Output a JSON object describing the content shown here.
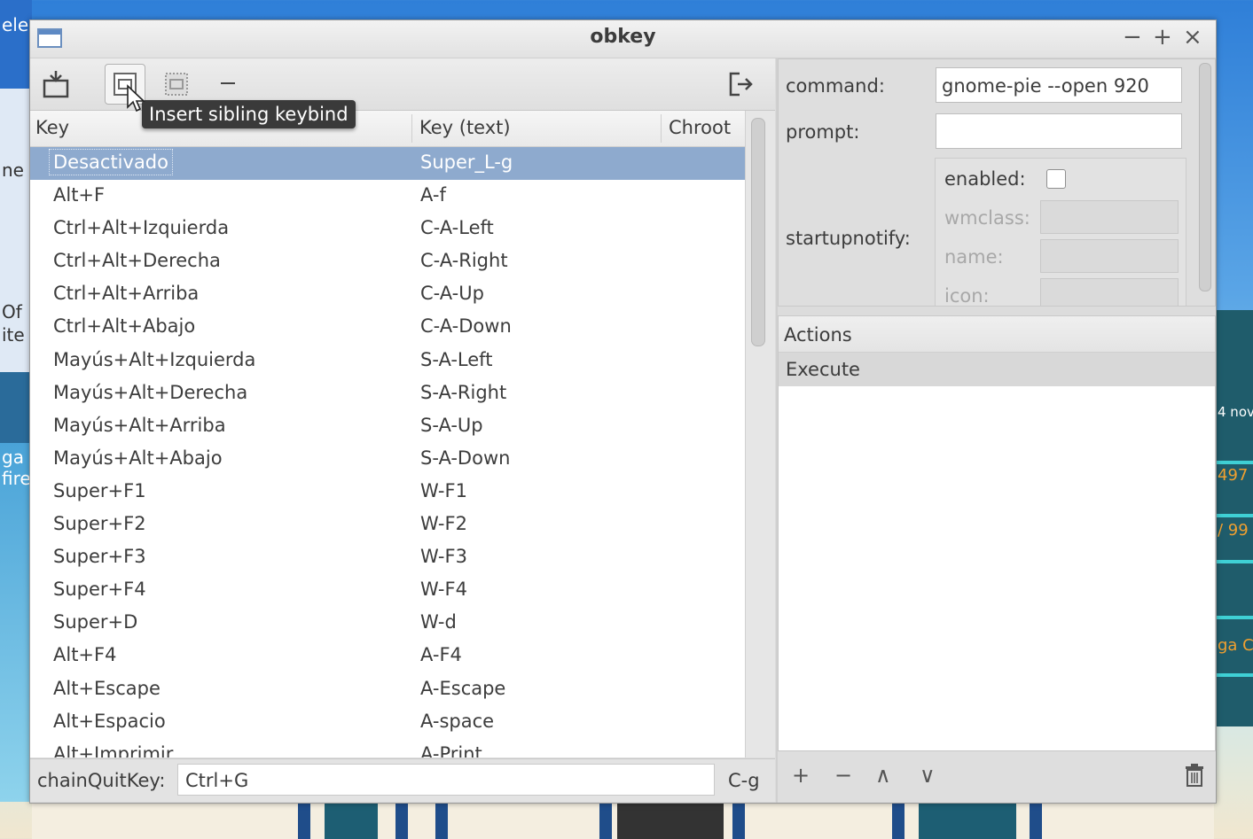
{
  "window": {
    "title": "obkey",
    "controls": {
      "minimize": "−",
      "maximize": "+",
      "close": "×"
    }
  },
  "desktop": {
    "fragments": [
      "ele",
      "ne",
      "Of",
      "ite",
      "ga",
      "fire",
      "4 nov",
      "497",
      "/ 99",
      "ga C"
    ]
  },
  "toolbar": {
    "tooltip": "Insert sibling keybind"
  },
  "table": {
    "headers": {
      "key": "Key",
      "key_text": "Key (text)",
      "chroot": "Chroot"
    },
    "rows": [
      {
        "key": "Desactivado",
        "key_text": "Super_L-g",
        "selected": true
      },
      {
        "key": "Alt+F",
        "key_text": "A-f"
      },
      {
        "key": "Ctrl+Alt+Izquierda",
        "key_text": "C-A-Left"
      },
      {
        "key": "Ctrl+Alt+Derecha",
        "key_text": "C-A-Right"
      },
      {
        "key": "Ctrl+Alt+Arriba",
        "key_text": "C-A-Up"
      },
      {
        "key": "Ctrl+Alt+Abajo",
        "key_text": "C-A-Down"
      },
      {
        "key": "Mayús+Alt+Izquierda",
        "key_text": "S-A-Left"
      },
      {
        "key": "Mayús+Alt+Derecha",
        "key_text": "S-A-Right"
      },
      {
        "key": "Mayús+Alt+Arriba",
        "key_text": "S-A-Up"
      },
      {
        "key": "Mayús+Alt+Abajo",
        "key_text": "S-A-Down"
      },
      {
        "key": "Super+F1",
        "key_text": "W-F1"
      },
      {
        "key": "Super+F2",
        "key_text": "W-F2"
      },
      {
        "key": "Super+F3",
        "key_text": "W-F3"
      },
      {
        "key": "Super+F4",
        "key_text": "W-F4"
      },
      {
        "key": "Super+D",
        "key_text": "W-d"
      },
      {
        "key": "Alt+F4",
        "key_text": "A-F4"
      },
      {
        "key": "Alt+Escape",
        "key_text": "A-Escape"
      },
      {
        "key": "Alt+Espacio",
        "key_text": "A-space"
      },
      {
        "key": "Alt+Imprimir",
        "key_text": "A-Print"
      }
    ]
  },
  "chain_quit": {
    "label": "chainQuitKey:",
    "value": "Ctrl+G",
    "text": "C-g"
  },
  "properties": {
    "command_label": "command:",
    "command_value": "gnome-pie --open 920",
    "prompt_label": "prompt:",
    "prompt_value": "",
    "startupnotify_label": "startupnotify:",
    "enabled_label": "enabled:",
    "enabled_checked": false,
    "wmclass_label": "wmclass:",
    "name_label": "name:",
    "icon_label": "icon:"
  },
  "actions": {
    "header": "Actions",
    "items": [
      "Execute"
    ],
    "buttons": {
      "add": "+",
      "remove": "−",
      "up": "∧",
      "down": "∨"
    }
  }
}
